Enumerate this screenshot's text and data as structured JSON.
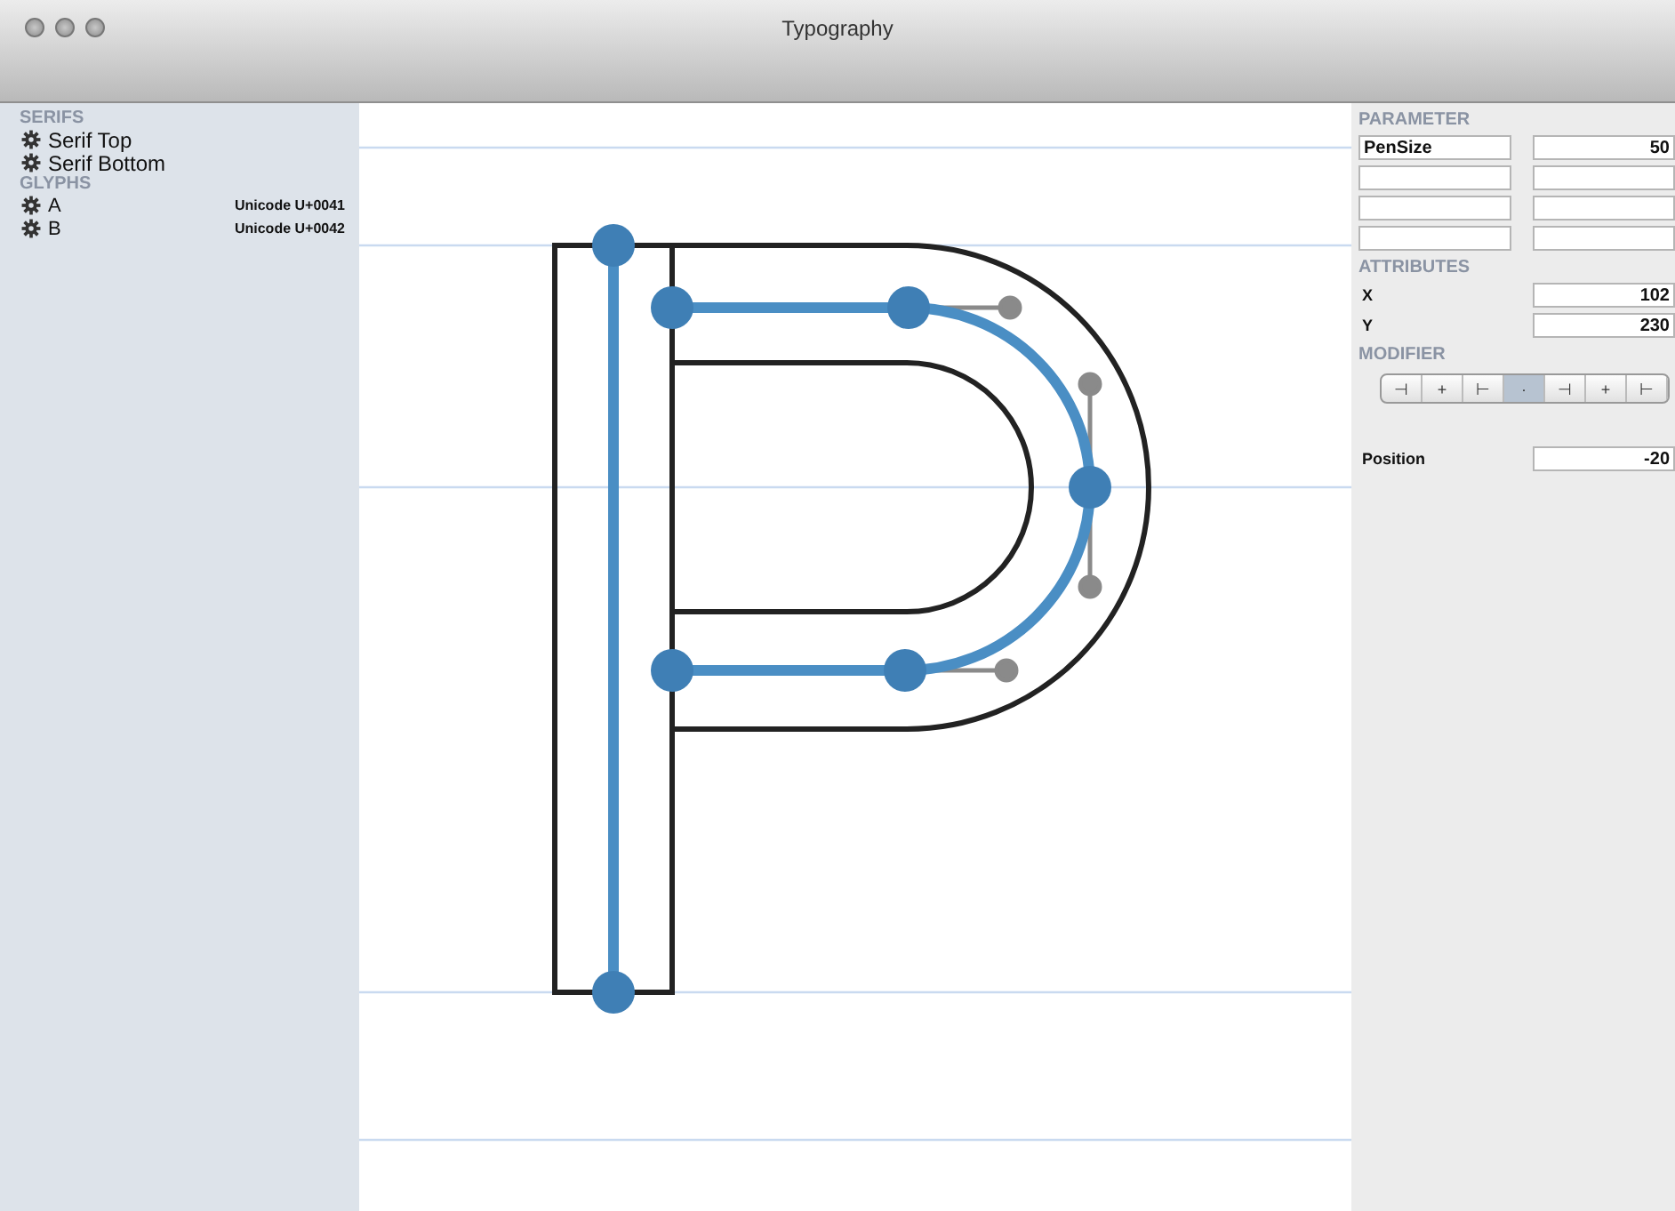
{
  "window": {
    "title": "Typography"
  },
  "sidebar": {
    "groups": [
      {
        "heading": "SERIFS",
        "items": [
          {
            "label": "Serif Top"
          },
          {
            "label": "Serif Bottom"
          }
        ]
      },
      {
        "heading": "GLYPHS",
        "items": [
          {
            "label": "A",
            "detail": "Unicode U+0041"
          },
          {
            "label": "B",
            "detail": "Unicode U+0042"
          }
        ]
      }
    ]
  },
  "parameter": {
    "heading": "PARAMETER",
    "rows": [
      {
        "kind": "filled",
        "name": "PenSize",
        "value": "50"
      },
      {
        "kind": "empty"
      },
      {
        "kind": "empty"
      },
      {
        "kind": "empty"
      }
    ]
  },
  "attributes": {
    "heading": "ATTRIBUTES",
    "rows": [
      {
        "label": "X",
        "value": "102"
      },
      {
        "label": "Y",
        "value": "230"
      }
    ]
  },
  "modifier": {
    "heading": "MODIFIER",
    "segments": [
      {
        "label": "⊣",
        "selected": false
      },
      {
        "label": "+",
        "selected": false
      },
      {
        "label": "⊢",
        "selected": false
      },
      {
        "label": "·",
        "selected": true
      },
      {
        "label": "⊣",
        "selected": false
      },
      {
        "label": "+",
        "selected": false
      },
      {
        "label": "⊢",
        "selected": false
      }
    ]
  },
  "position": {
    "label": "Position",
    "value": "-20"
  }
}
